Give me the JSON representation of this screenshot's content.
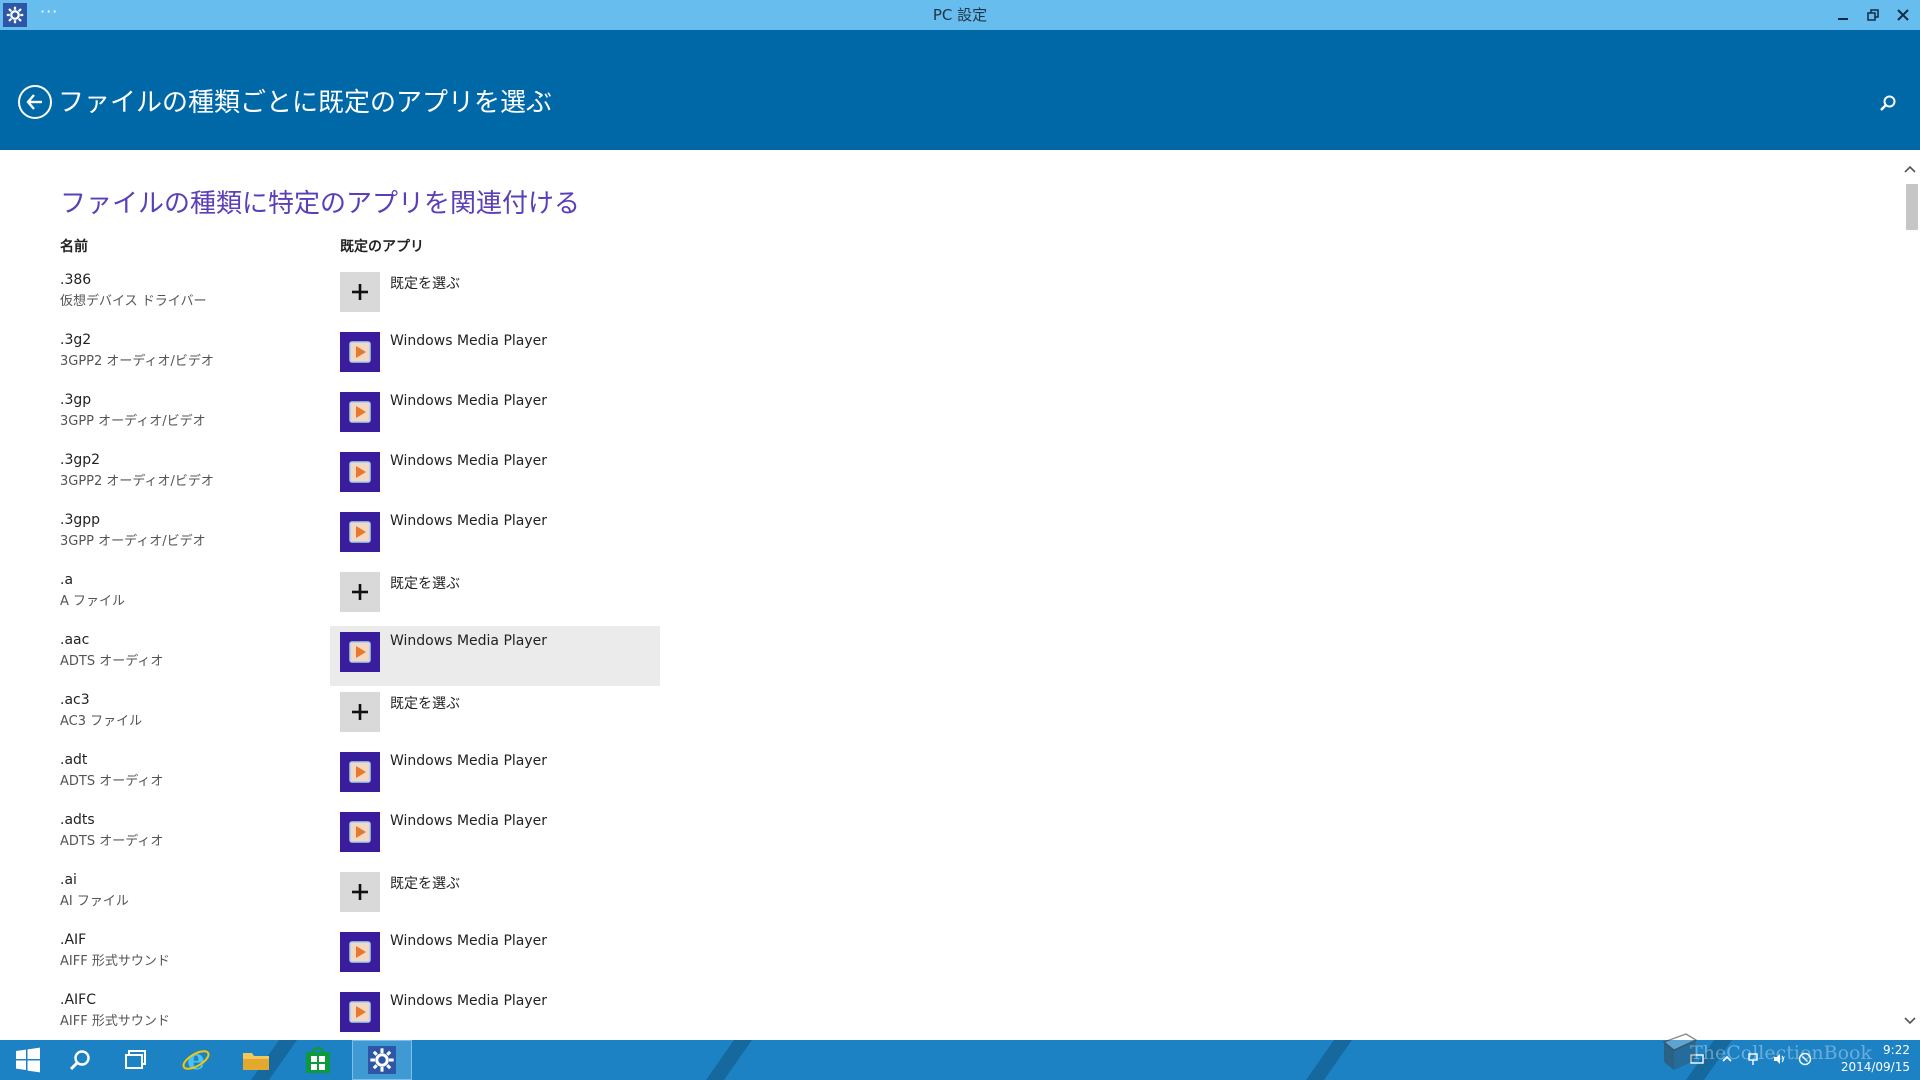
{
  "window": {
    "title": "PC 設定",
    "dots": "···"
  },
  "header": {
    "title": "ファイルの種類ごとに既定のアプリを選ぶ"
  },
  "main": {
    "section_title": "ファイルの種類に特定のアプリを関連付ける",
    "col_name": "名前",
    "col_app": "既定のアプリ",
    "rows": [
      {
        "ext": ".386",
        "desc": "仮想デバイス ドライバー",
        "app": "既定を選ぶ",
        "kind": "plus"
      },
      {
        "ext": ".3g2",
        "desc": "3GPP2 オーディオ/ビデオ",
        "app": "Windows Media Player",
        "kind": "wmp"
      },
      {
        "ext": ".3gp",
        "desc": "3GPP オーディオ/ビデオ",
        "app": "Windows Media Player",
        "kind": "wmp"
      },
      {
        "ext": ".3gp2",
        "desc": "3GPP2 オーディオ/ビデオ",
        "app": "Windows Media Player",
        "kind": "wmp"
      },
      {
        "ext": ".3gpp",
        "desc": "3GPP オーディオ/ビデオ",
        "app": "Windows Media Player",
        "kind": "wmp"
      },
      {
        "ext": ".a",
        "desc": "A ファイル",
        "app": "既定を選ぶ",
        "kind": "plus"
      },
      {
        "ext": ".aac",
        "desc": "ADTS オーディオ",
        "app": "Windows Media Player",
        "kind": "wmp",
        "hover": true
      },
      {
        "ext": ".ac3",
        "desc": "AC3 ファイル",
        "app": "既定を選ぶ",
        "kind": "plus"
      },
      {
        "ext": ".adt",
        "desc": "ADTS オーディオ",
        "app": "Windows Media Player",
        "kind": "wmp"
      },
      {
        "ext": ".adts",
        "desc": "ADTS オーディオ",
        "app": "Windows Media Player",
        "kind": "wmp"
      },
      {
        "ext": ".ai",
        "desc": "AI ファイル",
        "app": "既定を選ぶ",
        "kind": "plus"
      },
      {
        "ext": ".AIF",
        "desc": "AIFF 形式サウンド",
        "app": "Windows Media Player",
        "kind": "wmp"
      },
      {
        "ext": ".AIFC",
        "desc": "AIFF 形式サウンド",
        "app": "Windows Media Player",
        "kind": "wmp"
      }
    ]
  },
  "taskbar": {
    "clock_time": "9:22",
    "clock_date": "2014/09/15",
    "watermark": "TheCollectionBook"
  },
  "colors": {
    "titlebar": "#67bdee",
    "header": "#0168a8",
    "accent_title": "#5a3fb8",
    "wmp_tile": "#3a1d9c",
    "taskbar": "#1c82c4"
  }
}
